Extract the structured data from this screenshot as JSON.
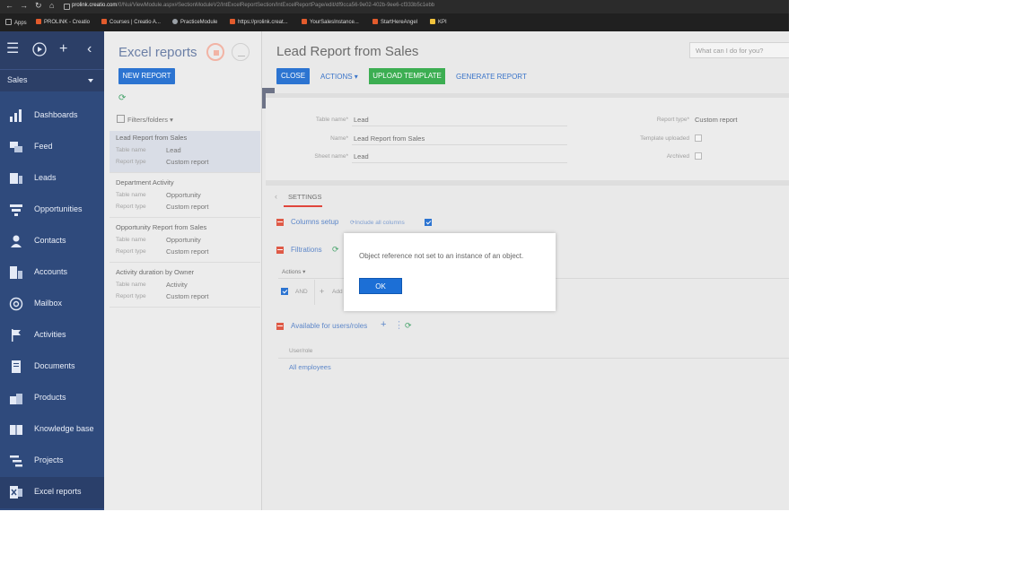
{
  "browser": {
    "url_host": "prolink.creatio.com",
    "url_path": "/0/Nui/ViewModule.aspx#SectionModuleV2/IntExcelReportSection/IntExcelReportPage/edit/df9cca56-9e02-402b-9ee6-cf333b5c1ebb",
    "bookmarks": [
      "Apps",
      "PROLINK - Creatio",
      "Courses | Creatio A...",
      "PracticeModule",
      "https://prolink.creat...",
      "YourSalesInstance...",
      "StartHereAngel",
      "KPI"
    ]
  },
  "sidebar": {
    "workplace": "Sales",
    "items": [
      {
        "label": "Dashboards",
        "icon": "dashboards-icon"
      },
      {
        "label": "Feed",
        "icon": "feed-icon"
      },
      {
        "label": "Leads",
        "icon": "leads-icon"
      },
      {
        "label": "Opportunities",
        "icon": "funnel-icon"
      },
      {
        "label": "Contacts",
        "icon": "contact-icon"
      },
      {
        "label": "Accounts",
        "icon": "building-icon"
      },
      {
        "label": "Mailbox",
        "icon": "at-icon"
      },
      {
        "label": "Activities",
        "icon": "flag-icon"
      },
      {
        "label": "Documents",
        "icon": "document-icon"
      },
      {
        "label": "Products",
        "icon": "products-icon"
      },
      {
        "label": "Knowledge base",
        "icon": "book-icon"
      },
      {
        "label": "Projects",
        "icon": "projects-icon"
      },
      {
        "label": "Excel reports",
        "icon": "excel-icon"
      }
    ]
  },
  "section": {
    "title": "Excel reports",
    "new_report": "NEW REPORT",
    "filters": "Filters/folders",
    "table_name_key": "Table name",
    "report_type_key": "Report type",
    "reports": [
      {
        "name": "Lead Report from Sales",
        "table": "Lead",
        "type": "Custom report"
      },
      {
        "name": "Department Activity",
        "table": "Opportunity",
        "type": "Custom report"
      },
      {
        "name": "Opportunity Report from Sales",
        "table": "Opportunity",
        "type": "Custom report"
      },
      {
        "name": "Activity duration by Owner",
        "table": "Activity",
        "type": "Custom report"
      }
    ]
  },
  "main": {
    "title": "Lead Report from Sales",
    "search_placeholder": "What can I do for you?",
    "close": "CLOSE",
    "actions": "ACTIONS",
    "upload_template": "UPLOAD TEMPLATE",
    "generate_report": "GENERATE REPORT",
    "fields": {
      "table_name_label": "Table name*",
      "table_name": "Lead",
      "name_label": "Name*",
      "name": "Lead Report from Sales",
      "sheet_name_label": "Sheet name*",
      "sheet_name": "Lead",
      "report_type_label": "Report type*",
      "report_type": "Custom report",
      "template_uploaded_label": "Template uploaded",
      "archived_label": "Archived"
    },
    "settings_tab": "SETTINGS",
    "columns_setup": "Columns setup",
    "include_all_columns": "Include all columns",
    "filtrations": "Filtrations",
    "actions_small": "Actions",
    "and_label": "AND",
    "add_condition": "Add",
    "available_for": "Available for users/roles",
    "user_role_header": "User/role",
    "user_role_value": "All employees"
  },
  "modal": {
    "message": "Object reference not set to an instance of an object.",
    "ok": "OK"
  }
}
